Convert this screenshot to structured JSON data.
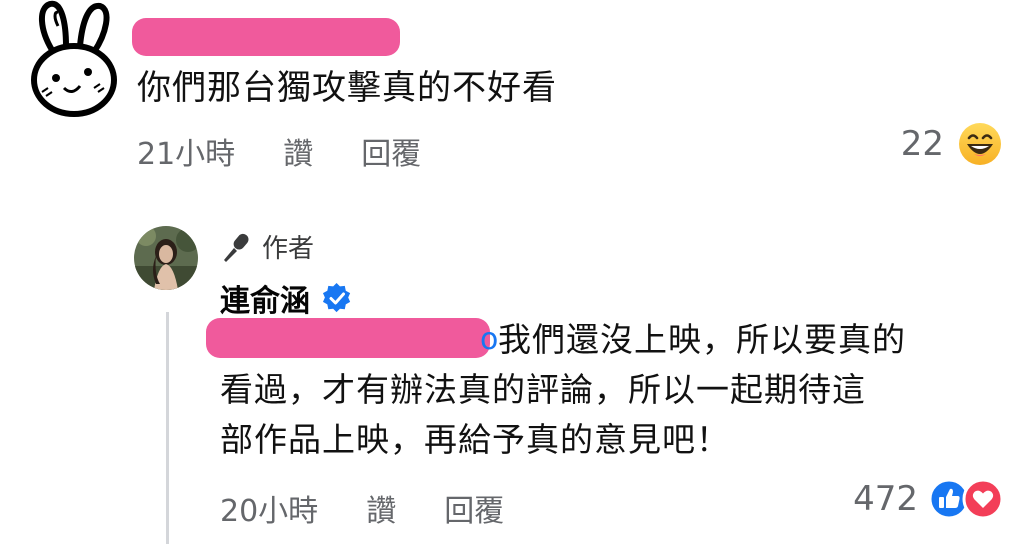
{
  "top_comment": {
    "text": "你們那台獨攻擊真的不好看",
    "time": "21小時",
    "like_label": "讚",
    "reply_label": "回覆",
    "reaction_count": "22",
    "reaction_icon": "laugh-emoji-icon"
  },
  "reply": {
    "author_badge": "作者",
    "author_name": "連俞涵",
    "mention_tail": "o",
    "text_line1": "我們還沒上映，所以要真的",
    "text_line2": "看過，才有辦法真的評論，所以一起期待這",
    "text_line3": "部作品上映，再給予真的意見吧！",
    "time": "20小時",
    "like_label": "讚",
    "reply_label": "回覆",
    "reaction_count": "472",
    "reaction_icons": [
      "like-icon",
      "love-icon"
    ]
  },
  "colors": {
    "redaction": "#f05a9c",
    "meta_gray": "#65676b",
    "facebook_blue": "#1877f2",
    "love_red": "#f33e58"
  }
}
